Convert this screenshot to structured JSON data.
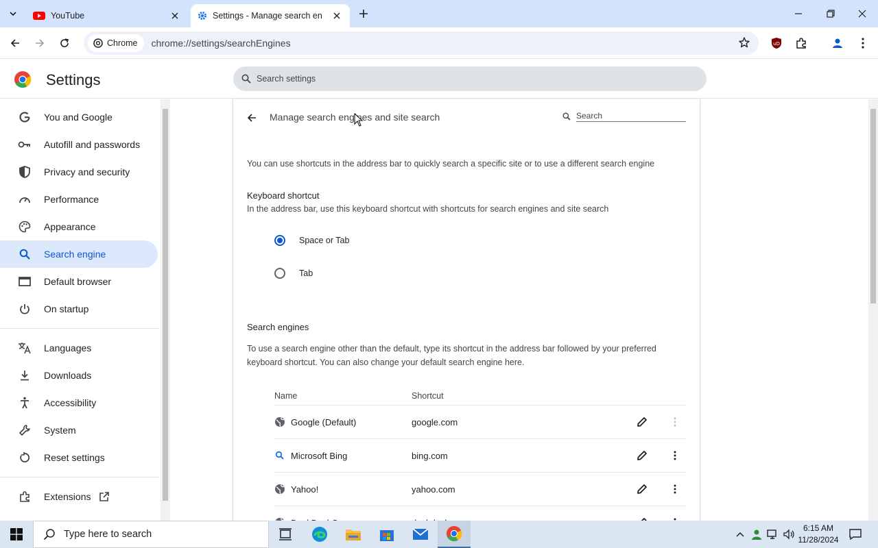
{
  "browser": {
    "tabs": [
      {
        "title": "YouTube",
        "active": false,
        "icon": "youtube-icon"
      },
      {
        "title": "Settings - Manage search engi",
        "active": true,
        "icon": "settings-gear-icon"
      }
    ],
    "chip_label": "Chrome",
    "url": "chrome://settings/searchEngines"
  },
  "settings": {
    "title": "Settings",
    "search_placeholder": "Search settings",
    "nav": [
      {
        "label": "You and Google",
        "icon": "google-g-icon"
      },
      {
        "label": "Autofill and passwords",
        "icon": "key-icon"
      },
      {
        "label": "Privacy and security",
        "icon": "shield-icon"
      },
      {
        "label": "Performance",
        "icon": "gauge-icon"
      },
      {
        "label": "Appearance",
        "icon": "palette-icon"
      },
      {
        "label": "Search engine",
        "icon": "search-icon",
        "selected": true
      },
      {
        "label": "Default browser",
        "icon": "browser-window-icon"
      },
      {
        "label": "On startup",
        "icon": "power-icon"
      },
      {
        "label": "Languages",
        "icon": "translate-icon"
      },
      {
        "label": "Downloads",
        "icon": "download-icon"
      },
      {
        "label": "Accessibility",
        "icon": "accessibility-icon"
      },
      {
        "label": "System",
        "icon": "wrench-icon"
      },
      {
        "label": "Reset settings",
        "icon": "reset-icon"
      },
      {
        "label": "Extensions",
        "icon": "puzzle-icon"
      }
    ]
  },
  "page": {
    "title": "Manage search engines and site search",
    "search_placeholder": "Search",
    "intro": "You can use shortcuts in the address bar to quickly search a specific site or to use a different search engine",
    "keyboard_heading": "Keyboard shortcut",
    "keyboard_desc": "In the address bar, use this keyboard shortcut with shortcuts for search engines and site search",
    "radio_options": [
      {
        "label": "Space or Tab",
        "checked": true
      },
      {
        "label": "Tab",
        "checked": false
      }
    ],
    "engines_heading": "Search engines",
    "engines_desc_1": "To use a search engine other than the default, type its shortcut in the address bar followed by your preferred",
    "engines_desc_2": "keyboard shortcut. You can also change your default search engine here.",
    "columns": {
      "name": "Name",
      "shortcut": "Shortcut"
    },
    "engines": [
      {
        "name": "Google (Default)",
        "shortcut": "google.com",
        "icon": "globe-icon"
      },
      {
        "name": "Microsoft Bing",
        "shortcut": "bing.com",
        "icon": "bing-search-icon"
      },
      {
        "name": "Yahoo!",
        "shortcut": "yahoo.com",
        "icon": "globe-icon"
      },
      {
        "name": "DuckDuckGo",
        "shortcut": "duckduckgo.com",
        "icon": "globe-icon"
      }
    ]
  },
  "taskbar": {
    "search_placeholder": "Type here to search",
    "time": "6:15 AM",
    "date": "11/28/2024"
  },
  "colors": {
    "accent": "#0b57d0",
    "selected_bg": "#dce8fb",
    "tabstrip": "#d3e3fd"
  }
}
